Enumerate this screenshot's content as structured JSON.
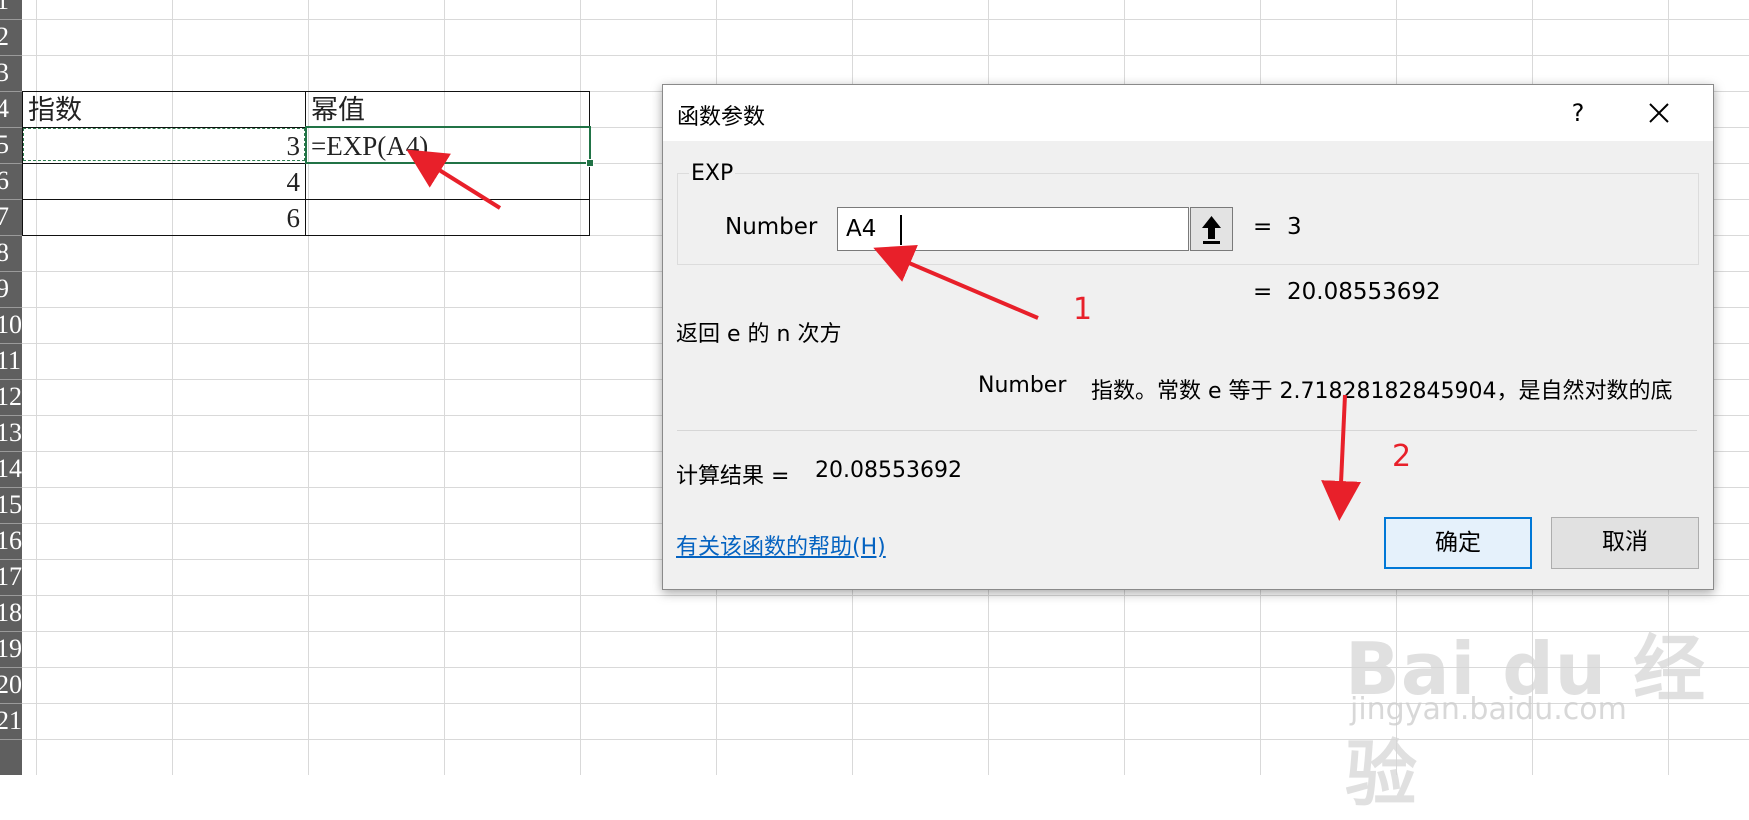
{
  "sheet": {
    "row_numbers": [
      "1",
      "2",
      "3",
      "4",
      "5",
      "6",
      "7",
      "8",
      "9",
      "10",
      "11",
      "12",
      "13",
      "14",
      "15",
      "16",
      "17",
      "18",
      "19",
      "20",
      "21"
    ],
    "header": {
      "a": "指数",
      "b": "幂值"
    },
    "rows": [
      {
        "a": "3",
        "b": "=EXP(A4)"
      },
      {
        "a": "4",
        "b": ""
      },
      {
        "a": "6",
        "b": ""
      }
    ]
  },
  "dialog": {
    "title": "函数参数",
    "help_button": "?",
    "close_button": "✕",
    "function_name": "EXP",
    "argument": {
      "label": "Number",
      "value": "A4",
      "eq": "=",
      "evaluated": "3"
    },
    "result_eq": "=",
    "result_value": "20.08553692",
    "function_description": "返回 e 的 n 次方",
    "argument_description_name": "Number",
    "argument_description_text": "指数。常数 e 等于 2.71828182845904，是自然对数的底",
    "calc_label": "计算结果 =",
    "calc_value": "20.08553692",
    "help_link": "有关该函数的帮助(H)",
    "ok_label": "确定",
    "cancel_label": "取消"
  },
  "annotations": {
    "step1": "1",
    "step2": "2",
    "color": "#e8202a"
  },
  "watermark": {
    "logo": "Bai du 经验",
    "url": "jingyan.baidu.com"
  }
}
